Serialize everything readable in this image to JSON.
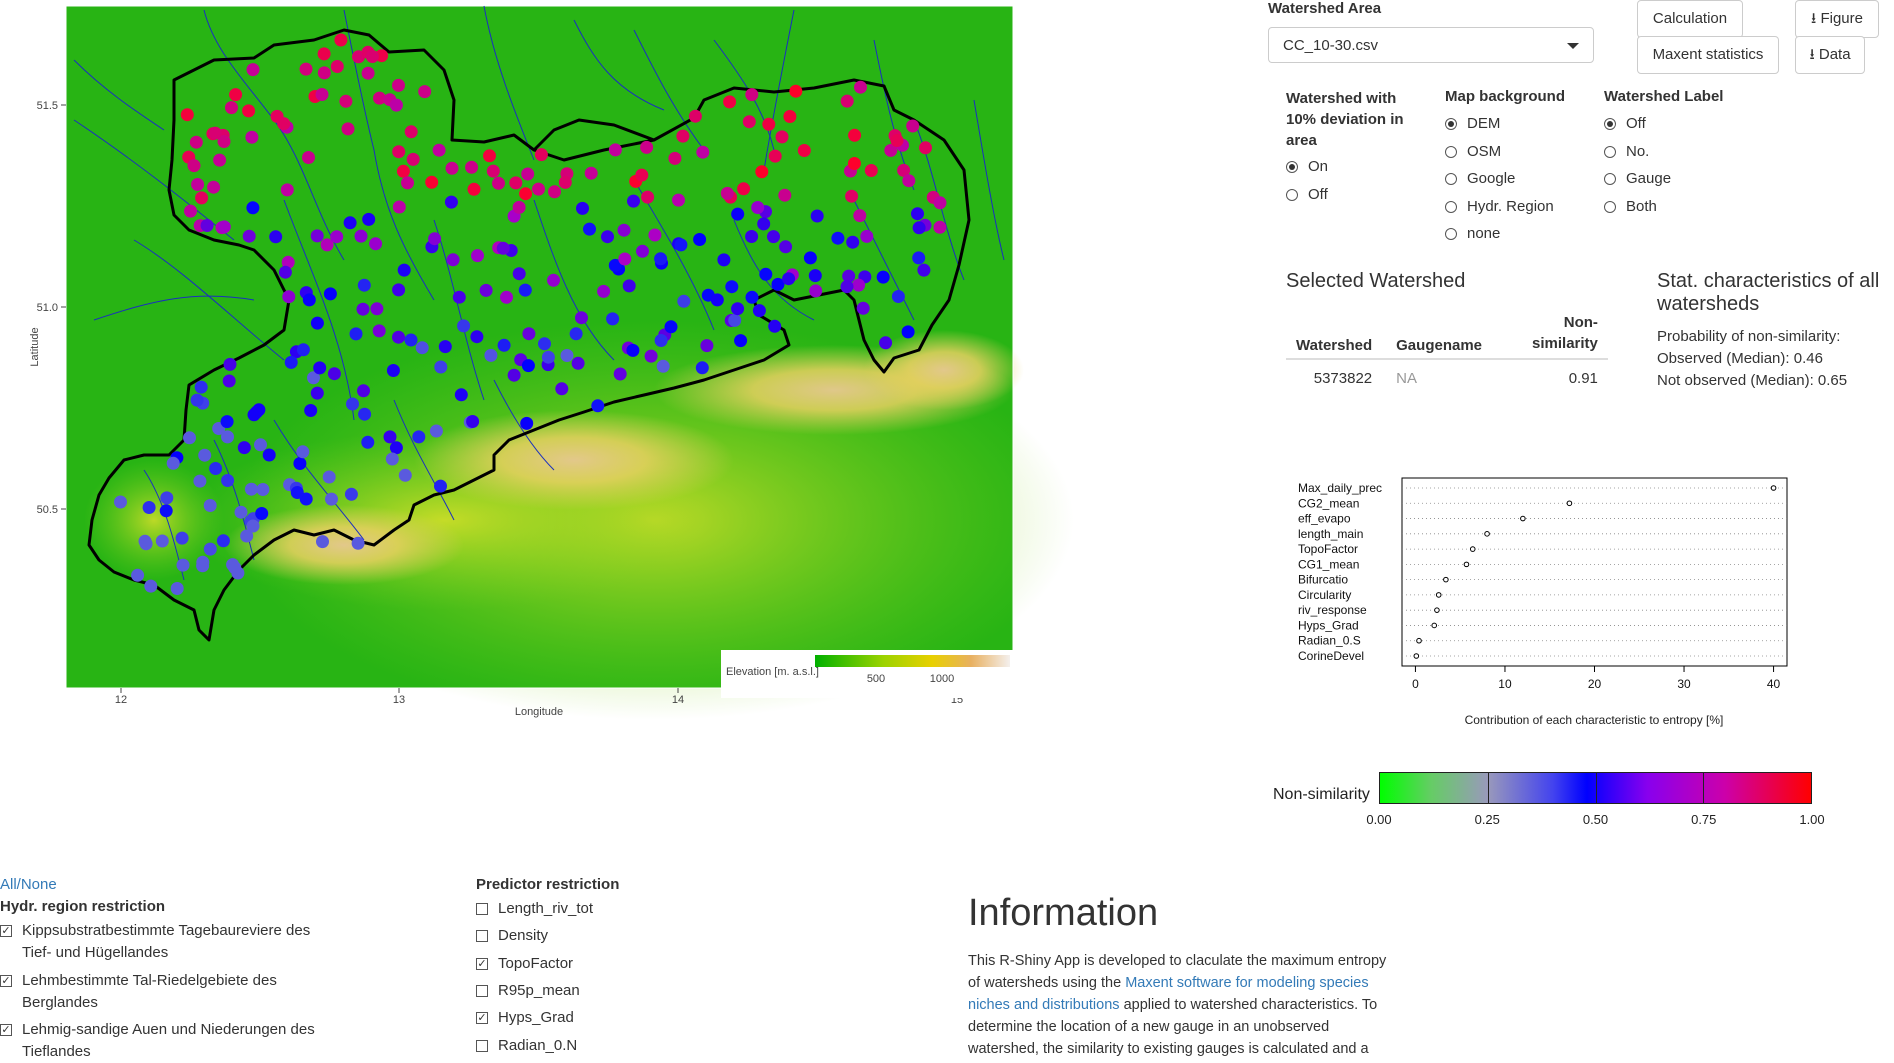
{
  "map": {
    "xlabel": "Longitude",
    "ylabel": "Latitude",
    "x_ticks": [
      "12",
      "13",
      "14",
      "15"
    ],
    "y_ticks": [
      "51.5",
      "51.0",
      "50.5"
    ],
    "legend_title": "Elevation [m. a.s.l.]",
    "legend_ticks": [
      "500",
      "1000"
    ]
  },
  "watershed_area": {
    "label": "Watershed Area",
    "selected": "CC_10-30.csv"
  },
  "buttons": {
    "calculation": "Calculation",
    "maxent_statistics": "Maxent statistics",
    "figure": "Figure",
    "data": "Data"
  },
  "deviation": {
    "label": "Watershed with 10% deviation in area",
    "label_lines": [
      "Watershed with",
      "10% deviation in",
      "area"
    ],
    "options": [
      "On",
      "Off"
    ],
    "selected": "On"
  },
  "map_background": {
    "label": "Map background",
    "options": [
      "DEM",
      "OSM",
      "Google",
      "Hydr. Region",
      "none"
    ],
    "selected": "DEM"
  },
  "watershed_label": {
    "label": "Watershed Label",
    "options": [
      "Off",
      "No.",
      "Gauge",
      "Both"
    ],
    "selected": "Off"
  },
  "selected_watershed": {
    "title": "Selected Watershed",
    "headers": [
      "Watershed",
      "Gaugename",
      "Non-",
      "similarity"
    ],
    "row": {
      "watershed": "5373822",
      "gaugename": "NA",
      "nonsim": "0.91"
    }
  },
  "stat_chars": {
    "title_lines": [
      "Stat. characteristics of all",
      "watersheds"
    ],
    "prob_label": "Probability of non-similarity:",
    "observed": "Observed (Median): 0.46",
    "not_observed": "Not observed (Median): 0.65"
  },
  "chart_data": {
    "type": "scatter",
    "categories": [
      "Max_daily_prec",
      "CG2_mean",
      "eff_evapo",
      "length_main",
      "TopoFactor",
      "CG1_mean",
      "Bifurcatio",
      "Circularity",
      "riv_response",
      "Hyps_Grad",
      "Radian_0.S",
      "CorineDevel"
    ],
    "values": [
      40.0,
      17.2,
      12.0,
      8.0,
      6.4,
      5.7,
      3.4,
      2.6,
      2.4,
      2.1,
      0.4,
      0.1
    ],
    "xlabel": "Contribution of each characteristic to entropy [%]",
    "x_ticks": [
      "0",
      "10",
      "20",
      "30",
      "40"
    ],
    "xlim": [
      -1.5,
      41.5
    ]
  },
  "colorbar": {
    "label": "Non-similarity",
    "ticks": [
      "0.00",
      "0.25",
      "0.50",
      "0.75",
      "1.00"
    ],
    "colors": [
      "#00ff00",
      "#8888cc",
      "#0000ff",
      "#9900cc",
      "#ff0000"
    ]
  },
  "hydr_region": {
    "all_none": "All/None",
    "label": "Hydr. region restriction",
    "items": [
      {
        "lines": [
          "Kippsubstratbestimmte Tagebaureviere des",
          "Tief- und Hügellandes"
        ],
        "checked": true
      },
      {
        "lines": [
          "Lehmbestimmte Tal-Riedelgebiete des",
          "Berglandes"
        ],
        "checked": true
      },
      {
        "lines": [
          "Lehmig-sandige Auen und Niederungen des",
          "Tieflandes"
        ],
        "checked": true
      }
    ]
  },
  "predictor": {
    "label": "Predictor restriction",
    "items": [
      {
        "label": "Length_riv_tot",
        "checked": false
      },
      {
        "label": "Density",
        "checked": false
      },
      {
        "label": "TopoFactor",
        "checked": true
      },
      {
        "label": "R95p_mean",
        "checked": false
      },
      {
        "label": "Hyps_Grad",
        "checked": true
      },
      {
        "label": "Radian_0.N",
        "checked": false
      }
    ]
  },
  "information": {
    "title": "Information",
    "lines": [
      "This R-Shiny App is developed to claculate the maximum entropy",
      "of watersheds using the",
      "Maxent software for modeling species",
      "niches and distributions",
      "applied to watershed characteristics. To",
      "determine the location of a new gauge in an unobserved",
      "watershed, the similarity to existing gauges is calculated and a"
    ]
  }
}
